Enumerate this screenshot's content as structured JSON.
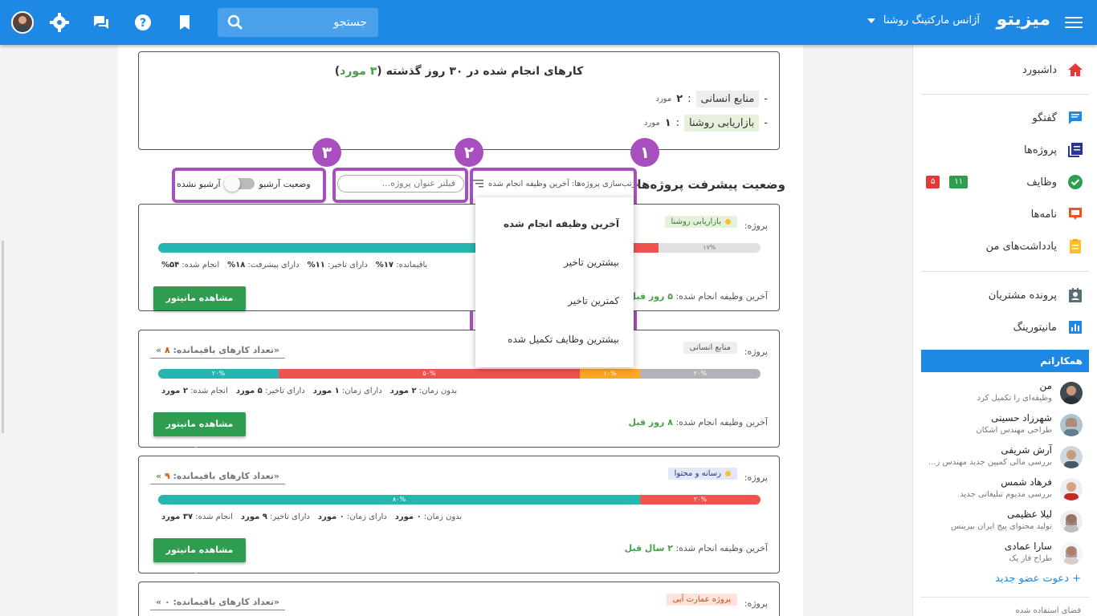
{
  "topbar": {
    "brand": "میزیتو",
    "org": "آژانس مارکتینگ روشنا",
    "search_placeholder": "جستجو"
  },
  "sidebar": {
    "items": [
      {
        "label": "داشبورد",
        "icon": "home-icon",
        "color": "#e53935"
      },
      {
        "label": "گفتگو",
        "icon": "chat-icon",
        "color": "#1e88e5"
      },
      {
        "label": "پروژه‌ها",
        "icon": "projects-icon",
        "color": "#283593"
      },
      {
        "label": "وظایف",
        "icon": "tasks-check-icon",
        "color": "#2e9d4f",
        "badge_green": "۱۱",
        "badge_red": "۵"
      },
      {
        "label": "نامه‌ها",
        "icon": "letters-icon",
        "color": "#f4511e"
      },
      {
        "label": "یادداشت‌های من",
        "icon": "notes-icon",
        "color": "#fbc02d"
      },
      {
        "label": "پرونده مشتریان",
        "icon": "customers-icon",
        "color": "#546e7a"
      },
      {
        "label": "مانیتورینگ",
        "icon": "monitoring-icon",
        "color": "#1e88e5"
      }
    ],
    "team_title": "همکارانم",
    "members": [
      {
        "name": "من",
        "desc": "وظیفه‌ای را تکمیل کرد"
      },
      {
        "name": "شهرزاد حسینی",
        "desc": "طراحی مهندس اشکان"
      },
      {
        "name": "آرش شریفی",
        "desc": "بررسی مالی کمپین جدید مهندس ز..."
      },
      {
        "name": "فرهاد شمس",
        "desc": "بررسی مدیوم تبلیغاتی جدید"
      },
      {
        "name": "لیلا عظیمی",
        "desc": "تولید محتوای پیج ایران بیزینس"
      },
      {
        "name": "سارا عمادی",
        "desc": "طراح فاز یک"
      }
    ],
    "invite": "دعوت عضو جدید",
    "space": "فضای استفاده شده"
  },
  "done": {
    "title_pre": "کارهای انجام شده در ۳۰ روز گذشته (",
    "count": "۳ مورد",
    "title_post": ")",
    "rows": [
      {
        "tag": "منابع انسانی",
        "sep": ":",
        "val": "۲",
        "unit": "مورد"
      },
      {
        "tag": "بازاریابی روشنا",
        "sep": ":",
        "val": "۱",
        "unit": "مورد"
      }
    ]
  },
  "progress": {
    "title": "وضعیت پیشرفت پروژه‌ها:",
    "sort_label": "مرتب‌سازی پروژه‌ها: آخرین وظیفه انجام شده",
    "filter_placeholder": "فیلتر عنوان پروژه...",
    "archive_label": "وضعیت آرشیو",
    "archive_state": "آرشیو نشده",
    "markers": [
      "۱",
      "۲",
      "۳"
    ],
    "sort_options": [
      "آخرین وظیفه انجام شده",
      "بیشترین تاخیر",
      "کمترین تاخیر",
      "بیشترین وظایف تکمیل شده"
    ]
  },
  "projects_label": "پروژه:",
  "remaining_label": "«تعداد کارهای باقیمانده:",
  "monitor_button": "مشاهده مانیتور پروژه",
  "last_task_label": "آخرین وظیفه انجام شده:",
  "projects": [
    {
      "name": "بازاریابی روشنا",
      "remaining": "",
      "bar": [
        {
          "p": 54,
          "c": "#26b5b0",
          "t": ""
        },
        {
          "p": 18,
          "c": "#4db6ac",
          "t": "۱۸%",
          "hatch": true
        },
        {
          "p": 11,
          "c": "#ef5350",
          "t": "۱۱%"
        },
        {
          "p": 17,
          "c": "#e0e0e0",
          "t": "۱۷%"
        }
      ],
      "stats": [
        [
          "انجام شده:",
          "۵۴%"
        ],
        [
          "دارای پیشرفت:",
          "۱۸%"
        ],
        [
          "دارای تاخیر:",
          "۱۱%"
        ],
        [
          "باقیمانده:",
          "۱۷%"
        ]
      ],
      "last": "۵ روز قبل"
    },
    {
      "name": "منابع انسانی",
      "remaining": "۸",
      "bar": [
        {
          "p": 20,
          "c": "#26b5b0",
          "t": "۲۰%"
        },
        {
          "p": 50,
          "c": "#ef5350",
          "t": "۵۰%"
        },
        {
          "p": 10,
          "c": "#ffa726",
          "t": "۱۰%"
        },
        {
          "p": 20,
          "c": "#b0b4b8",
          "t": "۲۰%"
        }
      ],
      "stats": [
        [
          "انجام شده:",
          "۲ مورد"
        ],
        [
          "دارای تاخیر:",
          "۵ مورد"
        ],
        [
          "دارای زمان:",
          "۱ مورد"
        ],
        [
          "بدون زمان:",
          "۲ مورد"
        ]
      ],
      "last": "۸ روز قبل"
    },
    {
      "name": "رسانه و محتوا",
      "remaining": "۹",
      "bar": [
        {
          "p": 80,
          "c": "#26b5b0",
          "t": "۸۰%"
        },
        {
          "p": 20,
          "c": "#ef5350",
          "t": "۲۰%"
        }
      ],
      "stats": [
        [
          "انجام شده:",
          "۳۷ مورد"
        ],
        [
          "دارای تاخیر:",
          "۹ مورد"
        ],
        [
          "دارای زمان:",
          "۰ مورد"
        ],
        [
          "بدون زمان:",
          "۰ مورد"
        ]
      ],
      "last": "۲ سال قبل"
    },
    {
      "name": "پروژه عمارت آبی",
      "remaining": "۰"
    }
  ]
}
